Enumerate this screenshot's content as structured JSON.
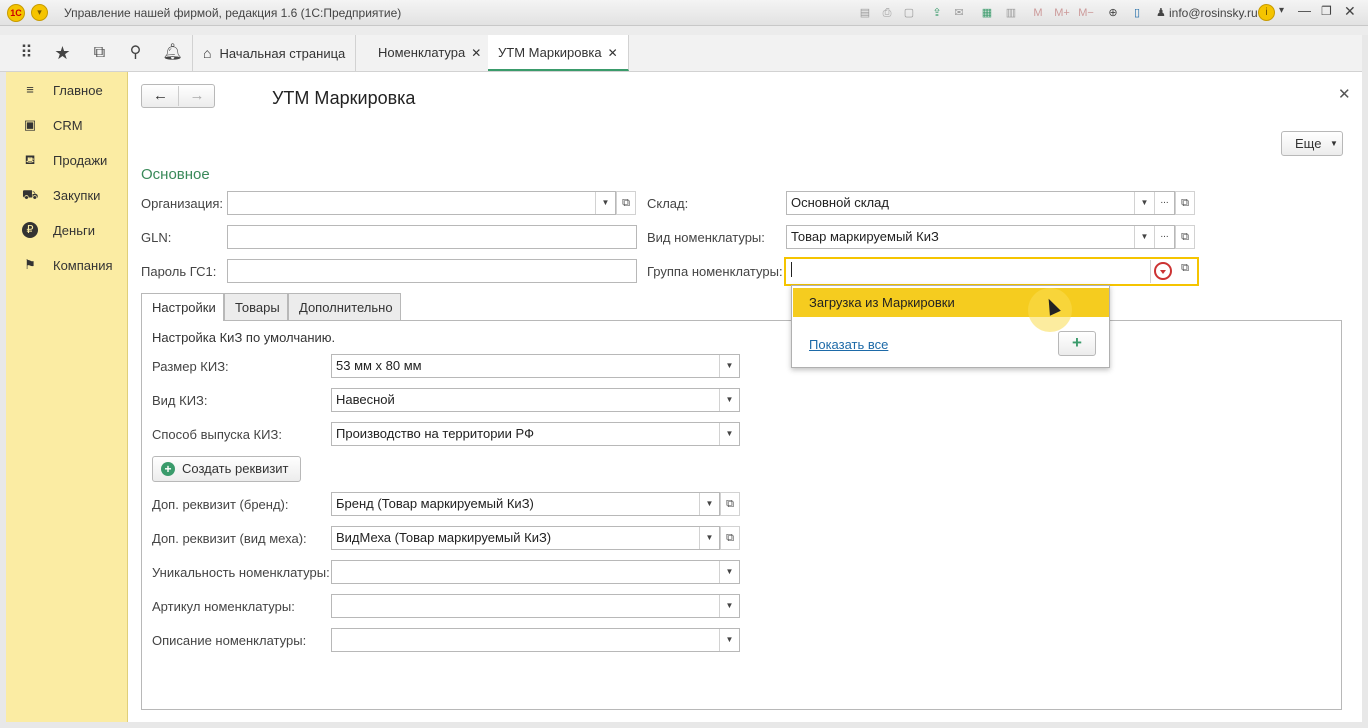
{
  "window": {
    "title": "Управление нашей фирмой, редакция 1.6  (1С:Предприятие)",
    "user": "info@rosinsky.ru",
    "logo": "1С"
  },
  "toolbar_icons": [
    "save-icon",
    "print-icon",
    "preview-icon",
    "upload-icon",
    "mail-icon",
    "calculator-icon",
    "calendar-icon",
    "m-icon",
    "m-plus-icon",
    "m-minus-icon",
    "zoom-icon",
    "panel-icon"
  ],
  "tabs": {
    "home": "Начальная страница",
    "nomenclature": "Номенклатура",
    "active": "УТМ Маркировка"
  },
  "sidebar": {
    "items": [
      {
        "label": "Главное",
        "icon": "menu-icon"
      },
      {
        "label": "CRM",
        "icon": "crm-icon"
      },
      {
        "label": "Продажи",
        "icon": "basket-icon"
      },
      {
        "label": "Закупки",
        "icon": "cart-icon"
      },
      {
        "label": "Деньги",
        "icon": "ruble-icon"
      },
      {
        "label": "Компания",
        "icon": "flag-icon"
      }
    ]
  },
  "form": {
    "title": "УТМ Маркировка",
    "more_label": "Еще",
    "group_title": "Основное",
    "org_label": "Организация:",
    "org_value": "",
    "gln_label": "GLN:",
    "gln_value": "",
    "password_label": "Пароль ГС1:",
    "password_value": "",
    "warehouse_label": "Склад:",
    "warehouse_value": "Основной склад",
    "nomenclature_kind_label": "Вид номенклатуры:",
    "nomenclature_kind_value": "Товар маркируемый КиЗ",
    "nomenclature_group_label": "Группа номенклатуры:",
    "nomenclature_group_value": ""
  },
  "page_tabs": [
    "Настройки",
    "Товары",
    "Дополнительно"
  ],
  "settings": {
    "heading": "Настройка КиЗ по умолчанию.",
    "size_label": "Размер КИЗ:",
    "size_value": "53 мм х 80 мм",
    "kind_label": "Вид КИЗ:",
    "kind_value": "Навесной",
    "release_label": "Способ выпуска КИЗ:",
    "release_value": "Производство на территории РФ",
    "create_button": "Создать реквизит",
    "brand_label": "Доп. реквизит (бренд):",
    "brand_value": "Бренд (Товар маркируемый КиЗ)",
    "fur_label": "Доп. реквизит (вид меха):",
    "fur_value": "ВидМеха (Товар маркируемый КиЗ)",
    "unique_label": "Уникальность номенклатуры:",
    "unique_value": "",
    "article_label": "Артикул номенклатуры:",
    "article_value": "",
    "description_label": "Описание номенклатуры:",
    "description_value": ""
  },
  "dropdown": {
    "item": "Загрузка из Маркировки",
    "show_all": "Показать все",
    "add": "+"
  },
  "colors": {
    "sidebar_bg": "#fbeca3",
    "accent_green": "#3a8a5a",
    "highlight": "#f5cc1f",
    "link": "#1d6aa8"
  }
}
